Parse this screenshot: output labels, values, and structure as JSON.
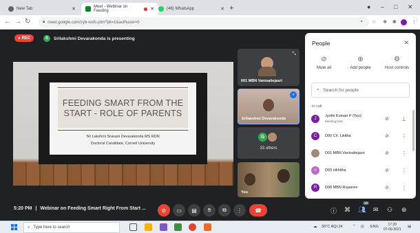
{
  "browser": {
    "tabs": [
      {
        "title": "New Tab",
        "active": false,
        "favicon_color": "#5f6368"
      },
      {
        "title": "Meet - Webinar on Feeding",
        "active": true,
        "favicon_color": "#00832d",
        "recording": true
      },
      {
        "title": "(46) WhatsApp",
        "active": false,
        "favicon_color": "#25d366"
      }
    ],
    "url": "meet.google.com/zyb-wsfc-ptm?pli=1&authuser=0"
  },
  "meet": {
    "rec_label": "REC",
    "presenter_initial": "S",
    "presenter_text": "Srilakshmi Devarakonda is presenting",
    "slide": {
      "title": "FEEDING SMART FROM THE START - ROLE OF PARENTS",
      "author": "Sri Lakshmi Sravani Devarakonda MS RDN",
      "affiliation": "Doctoral Candidate, Cornell University"
    },
    "tiles": [
      {
        "name": "001 MBN Vanisaitejasri"
      },
      {
        "name": "Srilakshmi Devarakonda"
      },
      {
        "initial": "G",
        "name": "33 others"
      },
      {
        "name": "You"
      }
    ],
    "bottom": {
      "time": "5:20 PM",
      "separator": "|",
      "meeting_title": "Webinar on Feeding Smart Right From Start ...",
      "chat_badge": "38"
    }
  },
  "people_panel": {
    "title": "People",
    "actions": [
      {
        "label": "Mute all",
        "icon": "mute-all-icon"
      },
      {
        "label": "Add people",
        "icon": "add-people-icon"
      },
      {
        "label": "Host controls",
        "icon": "host-controls-icon"
      }
    ],
    "search_placeholder": "Search for people",
    "section_label": "In call",
    "participants": [
      {
        "initial": "J",
        "name": "Jyothi Kumari P (You)",
        "role": "Meeting host",
        "color": "#7b1fa2"
      },
      {
        "initial": "C",
        "name": "D00 Ch. Likitha",
        "role": "",
        "color": "#7b1fa2"
      },
      {
        "initial": "",
        "name": "D01 MBN Vanisaitejasri",
        "role": "",
        "color": "#a1887f"
      },
      {
        "initial": "n",
        "name": "D03 nikhitha",
        "role": "",
        "color": "#ba68c8"
      },
      {
        "initial": "R",
        "name": "D08 MBN Rojasree",
        "role": "",
        "color": "#7b1fa2"
      }
    ]
  },
  "taskbar": {
    "search_placeholder": "Type here to search",
    "weather": "30°C AQI 24",
    "language": "ENG",
    "time": "17:20",
    "date": "07-09-2021"
  },
  "colors": {
    "meet_bg": "#202124",
    "accent_red": "#ea4335",
    "accent_blue": "#1a73e8"
  }
}
